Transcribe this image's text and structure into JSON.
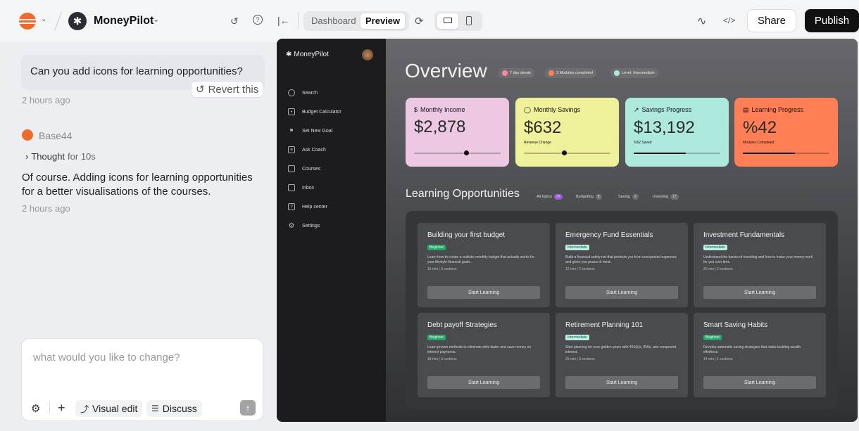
{
  "topbar": {
    "project_name": "MoneyPilot",
    "view_dashboard": "Dashboard",
    "view_preview": "Preview",
    "share_label": "Share",
    "publish_label": "Publish"
  },
  "chat": {
    "user_message": "Can you add icons for learning opportunities?",
    "revert_label": "Revert this",
    "user_time": "2 hours ago",
    "assistant_name": "Base44",
    "thought_prefix": "Thought",
    "thought_duration": "for 10s",
    "assistant_message": "Of course. Adding icons for learning opportunities for a better visualisations of the courses.",
    "assistant_time": "2 hours ago",
    "composer_placeholder": "what would you like to change?",
    "visual_edit_label": "Visual edit",
    "discuss_label": "Discuss"
  },
  "app": {
    "brand": "MoneyPilot",
    "nav": [
      "Search",
      "Budget Calculator",
      "Set New Goal",
      "Ask Coach",
      "Courses",
      "Inbox",
      "Help center",
      "Settings"
    ],
    "page_title": "Overview",
    "badges": [
      "7 day streak",
      "3 Modules completed",
      "Level: Intermediate"
    ],
    "cards": [
      {
        "title": "Monthly Income",
        "value": "$2,878",
        "sub": "",
        "color": "#ecc8e3",
        "progress": 0.6
      },
      {
        "title": "Monthly Savings",
        "value": "$632",
        "sub": "Revenue Change",
        "color": "#eef09a",
        "progress": 0.46
      },
      {
        "title": "Savings Progress",
        "value": "$13,192",
        "sub": "%52 Saved",
        "color": "#aee9de",
        "progress": 0.6
      },
      {
        "title": "Learning Progress",
        "value": "%42",
        "sub": "Modules Completed",
        "color": "#ff7e55",
        "progress": 0.6
      }
    ],
    "section_title": "Learning Opportunities",
    "filters": [
      {
        "label": "All topics",
        "count": "24"
      },
      {
        "label": "Budgeting",
        "count": "8"
      },
      {
        "label": "Saving",
        "count": "9"
      },
      {
        "label": "Investing",
        "count": "17"
      }
    ],
    "courses": [
      {
        "title": "Building your first budget",
        "level": "Beginner",
        "desc": "Learn how to create a realistic monthly budget that actually works for your lifestyle financial goals.",
        "meta": "15 min | 3 sections",
        "cta": "Start Learning"
      },
      {
        "title": "Emergency Fund Essentials",
        "level": "Intermediate",
        "desc": "Build a financial safety net that protects you from unexpected expenses and gives you peace of mind.",
        "meta": "12 min | 2 sections",
        "cta": "Start Learning"
      },
      {
        "title": "Investment Fundamentals",
        "level": "Intermediate",
        "desc": "Understand the basics of investing and how to make your money work for you over time.",
        "meta": "20 min | 2 sections",
        "cta": "Start Learning"
      },
      {
        "title": "Debt payoff Strategies",
        "level": "Beginner",
        "desc": "Learn proven methods to eliminate debt faster and save money on interest payments.",
        "meta": "18 min | 3 sections",
        "cta": "Start Learning"
      },
      {
        "title": "Retirement Planning 101",
        "level": "Intermediate",
        "desc": "Start planning for your golden years with 401(k)s, IRAs, and compound interest.",
        "meta": "25 min | 3 sections",
        "cta": "Start Learning"
      },
      {
        "title": "Smart Saving Habits",
        "level": "Beginner",
        "desc": "Develop automatic saving strategies that make building wealth effortless.",
        "meta": "14 min | 1 sections",
        "cta": "Start Learning"
      }
    ]
  }
}
